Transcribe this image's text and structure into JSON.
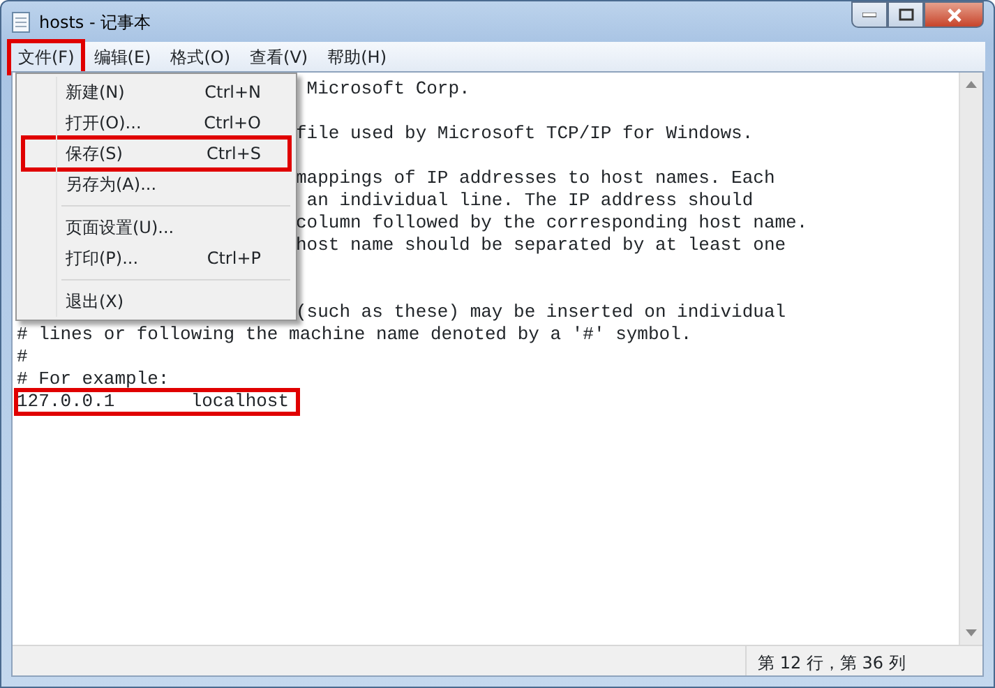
{
  "window": {
    "title": "hosts - 记事本"
  },
  "menubar": [
    {
      "label": "文件(F)",
      "selected": true,
      "highlighted": true
    },
    {
      "label": "编辑(E)",
      "selected": false,
      "highlighted": false
    },
    {
      "label": "格式(O)",
      "selected": false,
      "highlighted": false
    },
    {
      "label": "查看(V)",
      "selected": false,
      "highlighted": false
    },
    {
      "label": "帮助(H)",
      "selected": false,
      "highlighted": false
    }
  ],
  "file_menu": [
    {
      "kind": "item",
      "label": "新建(N)",
      "shortcut": "Ctrl+N",
      "highlighted": false
    },
    {
      "kind": "item",
      "label": "打开(O)...",
      "shortcut": "Ctrl+O",
      "highlighted": false
    },
    {
      "kind": "item",
      "label": "保存(S)",
      "shortcut": "Ctrl+S",
      "highlighted": true
    },
    {
      "kind": "item",
      "label": "另存为(A)...",
      "highlighted": false
    },
    {
      "kind": "separator"
    },
    {
      "kind": "item",
      "label": "页面设置(U)...",
      "highlighted": false
    },
    {
      "kind": "item",
      "label": "打印(P)...",
      "shortcut": "Ctrl+P",
      "highlighted": false
    },
    {
      "kind": "separator"
    },
    {
      "kind": "item",
      "label": "退出(X)",
      "highlighted": false
    }
  ],
  "editor_lines": [
    {
      "kind": "clipped",
      "text": " Microsoft Corp.",
      "highlighted": false
    },
    {
      "kind": "blank"
    },
    {
      "kind": "clipped",
      "text": "file used by Microsoft TCP/IP for Windows.",
      "highlighted": false
    },
    {
      "kind": "blank"
    },
    {
      "kind": "clipped",
      "text": "mappings of IP addresses to host names. Each",
      "highlighted": false
    },
    {
      "kind": "clipped",
      "text": " an individual line. The IP address should",
      "highlighted": false
    },
    {
      "kind": "clipped",
      "text": "column followed by the corresponding host name.",
      "highlighted": false
    },
    {
      "kind": "clipped",
      "text": "host name should be separated by at least one",
      "highlighted": false
    },
    {
      "kind": "blank"
    },
    {
      "kind": "blank"
    },
    {
      "kind": "clipped",
      "text": "(such as these) may be inserted on individual",
      "highlighted": false
    },
    {
      "kind": "full",
      "text": "# lines or following the machine name denoted by a '#' symbol.",
      "highlighted": false
    },
    {
      "kind": "full",
      "text": "#",
      "highlighted": false
    },
    {
      "kind": "full",
      "text": "# For example:",
      "highlighted": false
    },
    {
      "kind": "full",
      "text": "127.0.0.1       localhost",
      "highlighted": true
    }
  ],
  "status_bar": {
    "position": "第 12 行，第 36 列"
  }
}
